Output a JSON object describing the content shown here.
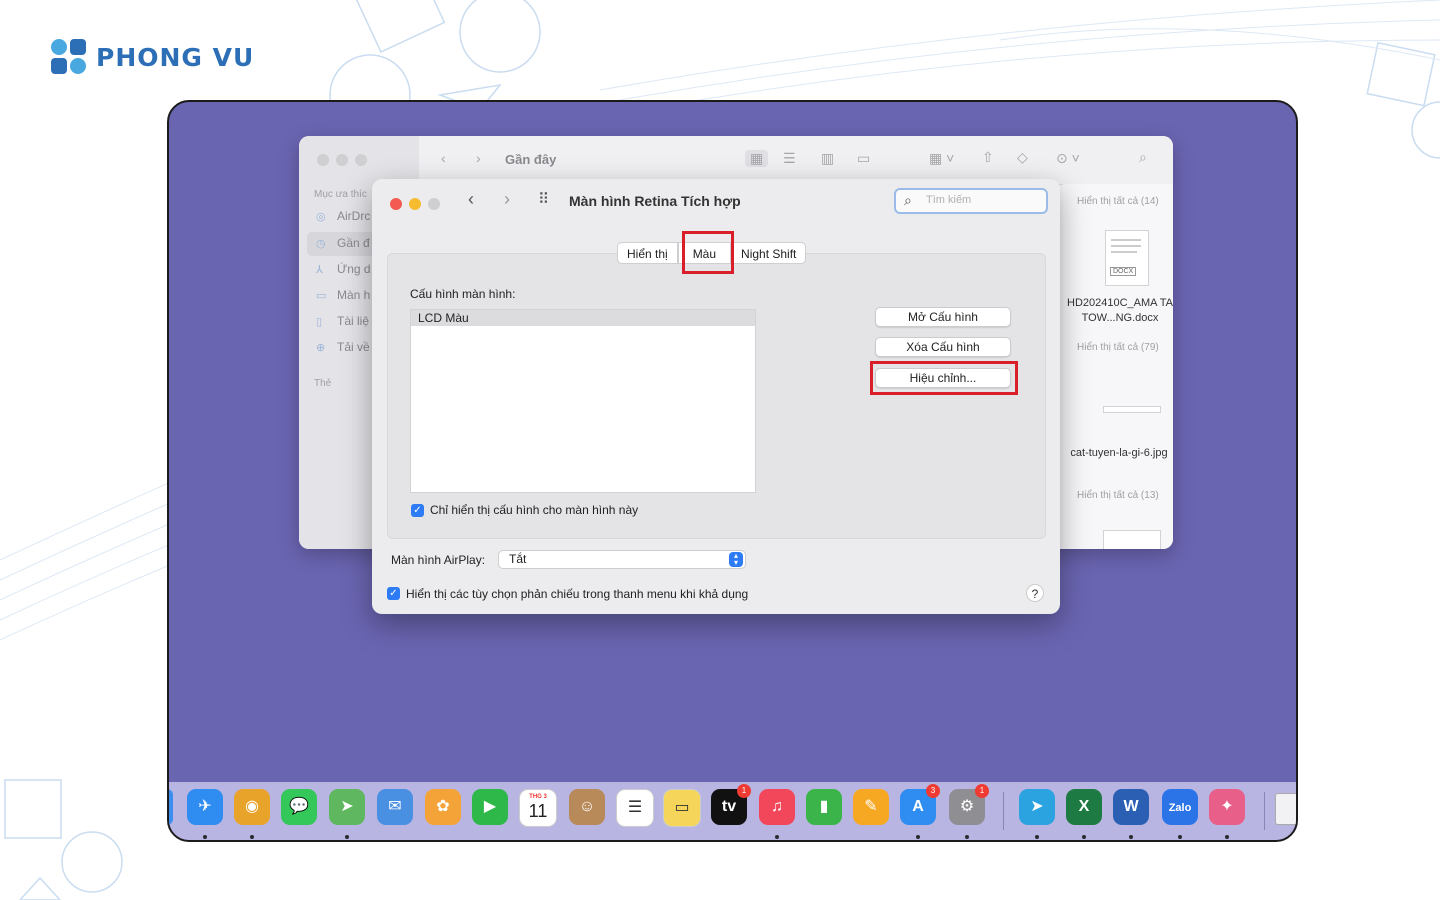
{
  "brand": {
    "name": "PHONG VU"
  },
  "finder": {
    "toolbar_title": "Gần đây",
    "sidebar_heading": "Mục ưa thíc",
    "sidebar_items": [
      "AirDrc",
      "Gần đ",
      "Ứng d",
      "Màn h",
      "Tài liệ",
      "Tải về"
    ],
    "sidebar_tags_heading": "Thẻ",
    "show_all_1": "Hiển thị tất cả (14)",
    "show_all_2": "Hiển thị tất cả (79)",
    "show_all_3": "Hiển thị tất cả (13)",
    "file_1": "HD202410C_AMA TA TOW...NG.docx",
    "file_2": "cat-tuyen-la-gi-6.jpg",
    "docx_tag": "DOCX"
  },
  "prefs": {
    "title": "Màn hình Retina Tích hợp",
    "search_placeholder": "Tìm kiếm",
    "tabs": [
      {
        "label": "Hiển thị",
        "selected": false
      },
      {
        "label": "Màu",
        "selected": true
      },
      {
        "label": "Night Shift",
        "selected": false
      }
    ],
    "profile_label": "Cấu hình màn hình:",
    "profiles": [
      "LCD Màu"
    ],
    "buttons": {
      "open_profile": "Mở Cấu hình",
      "delete_profile": "Xóa Cấu hình",
      "calibrate": "Hiệu chỉnh..."
    },
    "only_this_display": {
      "label": "Chỉ hiển thị cấu hình cho màn hình này",
      "checked": true
    },
    "airplay_label": "Màn hình AirPlay:",
    "airplay_value": "Tắt",
    "mirroring_option": {
      "label": "Hiển thị các tùy chọn phản chiếu trong thanh menu khi khả dụng",
      "checked": true
    },
    "help": "?"
  },
  "dock": {
    "icons": [
      {
        "name": "safari",
        "glyph": "✈",
        "color": "#2f8cf0",
        "running": true
      },
      {
        "name": "chrome",
        "glyph": "◉",
        "color": "#e8a32a",
        "running": true
      },
      {
        "name": "messages",
        "glyph": "💬",
        "color": "#34c759",
        "running": false
      },
      {
        "name": "maps",
        "glyph": "➤",
        "color": "#5fb85f",
        "running": true
      },
      {
        "name": "mail",
        "glyph": "✉",
        "color": "#4a90e2",
        "running": false
      },
      {
        "name": "photos",
        "glyph": "✿",
        "color": "#f4a338",
        "running": false
      },
      {
        "name": "facetime",
        "glyph": "▶",
        "color": "#2fb84a",
        "running": false
      },
      {
        "name": "calendar",
        "glyph": "11",
        "color": "#ffffff",
        "running": false
      },
      {
        "name": "contacts",
        "glyph": "☺",
        "color": "#b88a5a",
        "running": false
      },
      {
        "name": "reminders",
        "glyph": "☰",
        "color": "#ffffff",
        "running": false
      },
      {
        "name": "notes",
        "glyph": "▭",
        "color": "#f6d65a",
        "running": false
      },
      {
        "name": "apple-tv",
        "glyph": "tv",
        "color": "#111111",
        "running": false,
        "badge": "1"
      },
      {
        "name": "music",
        "glyph": "♫",
        "color": "#f2475b",
        "running": true
      },
      {
        "name": "numbers",
        "glyph": "▮",
        "color": "#3bb54a",
        "running": false
      },
      {
        "name": "pages",
        "glyph": "✎",
        "color": "#f7a823",
        "running": false
      },
      {
        "name": "app-store",
        "glyph": "A",
        "color": "#2f8cf0",
        "running": true,
        "badge": "3"
      },
      {
        "name": "system-preferences",
        "glyph": "⚙",
        "color": "#8e8e93",
        "running": true,
        "badge": "1"
      },
      {
        "name": "telegram",
        "glyph": "➤",
        "color": "#2aa3e0",
        "running": true
      },
      {
        "name": "excel",
        "glyph": "X",
        "color": "#1e7a43",
        "running": true
      },
      {
        "name": "word",
        "glyph": "W",
        "color": "#2b5fb3",
        "running": true
      },
      {
        "name": "zalo",
        "glyph": "Zalo",
        "color": "#2b74e8",
        "running": true
      },
      {
        "name": "color-picker",
        "glyph": "✦",
        "color": "#e85f8a",
        "running": true
      }
    ],
    "calendar_month": "THG 3"
  }
}
